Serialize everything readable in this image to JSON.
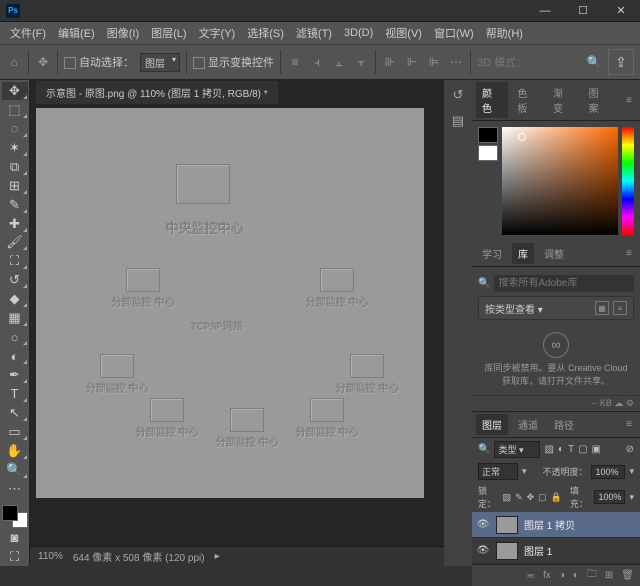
{
  "window": {
    "minimize": "—",
    "maximize": "☐",
    "close": "✕"
  },
  "menu": [
    "文件(F)",
    "编辑(E)",
    "图像(I)",
    "图层(L)",
    "文字(Y)",
    "选择(S)",
    "滤镜(T)",
    "3D(D)",
    "视图(V)",
    "窗口(W)",
    "帮助(H)"
  ],
  "options": {
    "autoSelectLabel": "自动选择：",
    "autoSelectValue": "图层",
    "showTransformLabel": "显示变换控件",
    "mode3d": "3D 模式："
  },
  "docTab": "示意图 - 原图.png @ 110% (图层 1 拷贝, RGB/8) *",
  "status": {
    "zoom": "110%",
    "info": "644 像素 x 508 像素 (120 ppi)"
  },
  "canvas": {
    "center": "中央监控中心",
    "network": "TCP/IP网络",
    "node": "分部监控\n中心"
  },
  "colorTabs": [
    "颜色",
    "色板",
    "渐变",
    "图案"
  ],
  "libTabs": [
    "学习",
    "库",
    "调整"
  ],
  "libSearchPlaceholder": "搜索所有Adobe库",
  "libDropdown": "按类型查看",
  "ccMessage": "库同步被禁用。要从 Creative Cloud 获取库，请打开文件共享。",
  "storage": "-- KB",
  "layersTabs": [
    "图层",
    "通道",
    "路径"
  ],
  "layers": {
    "kindLabel": "类型",
    "blend": "正常",
    "opacityLabel": "不透明度：",
    "opacity": "100%",
    "lockLabel": "锁定：",
    "fillLabel": "填充：",
    "fill": "100%",
    "items": [
      {
        "name": "图层 1 拷贝"
      },
      {
        "name": "图层 1"
      }
    ]
  }
}
